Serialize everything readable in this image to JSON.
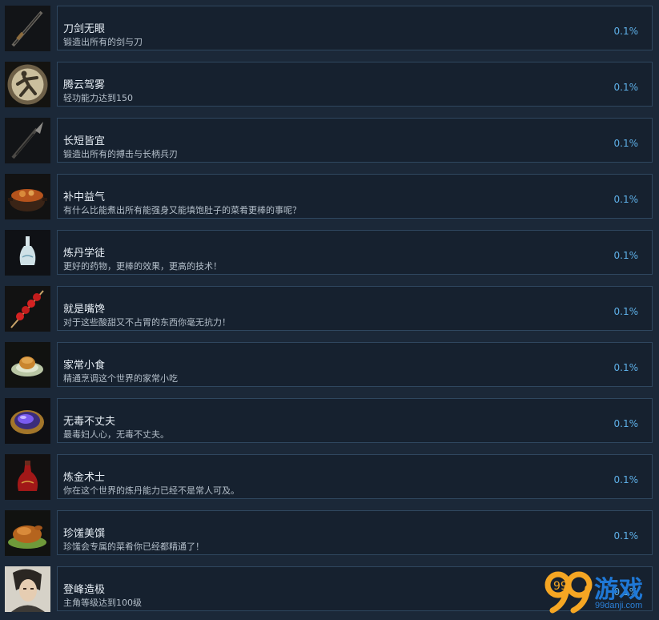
{
  "achievements": [
    {
      "title": "刀剑无眼",
      "desc": "锻造出所有的剑与刀",
      "percent": "0.1%",
      "icon": "sword-icon"
    },
    {
      "title": "腾云驾雾",
      "desc": "轻功能力达到150",
      "percent": "0.1%",
      "icon": "kung-fu-emblem-icon"
    },
    {
      "title": "长短皆宜",
      "desc": "锻造出所有的搏击与长柄兵刃",
      "percent": "0.1%",
      "icon": "spear-icon"
    },
    {
      "title": "补中益气",
      "desc": "有什么比能煮出所有能强身又能填饱肚子的菜肴更棒的事呢？",
      "percent": "0.1%",
      "icon": "stew-pot-icon"
    },
    {
      "title": "炼丹学徒",
      "desc": "更好的药物，更棒的效果，更高的技术！",
      "percent": "0.1%",
      "icon": "porcelain-vase-icon"
    },
    {
      "title": "就是嘴馋",
      "desc": "对于这些酸甜又不占胃的东西你毫无抗力！",
      "percent": "0.1%",
      "icon": "candied-haws-icon"
    },
    {
      "title": "家常小食",
      "desc": "精通烹调这个世界的家常小吃",
      "percent": "0.1%",
      "icon": "dumpling-plate-icon"
    },
    {
      "title": "无毒不丈夫",
      "desc": "最毒妇人心，无毒不丈夫。",
      "percent": "0.1%",
      "icon": "poison-bowl-icon"
    },
    {
      "title": "炼金术士",
      "desc": "你在这个世界的炼丹能力已经不是常人可及。",
      "percent": "0.1%",
      "icon": "red-flask-icon"
    },
    {
      "title": "珍馐美馔",
      "desc": "珍馐会专属的菜肴你已经都精通了！",
      "percent": "0.1%",
      "icon": "roast-chicken-icon"
    },
    {
      "title": "登峰造极",
      "desc": "主角等级达到100级",
      "percent": "0.1%",
      "icon": "hero-portrait-icon"
    }
  ],
  "watermark": {
    "brand_number": "99",
    "brand_text": "游戏",
    "url": "99danji.com"
  },
  "colors": {
    "background": "#1b2838",
    "card": "#16212f",
    "card_border": "#2f475f",
    "percent": "#5eb0e8",
    "watermark": "#1f78d6"
  }
}
